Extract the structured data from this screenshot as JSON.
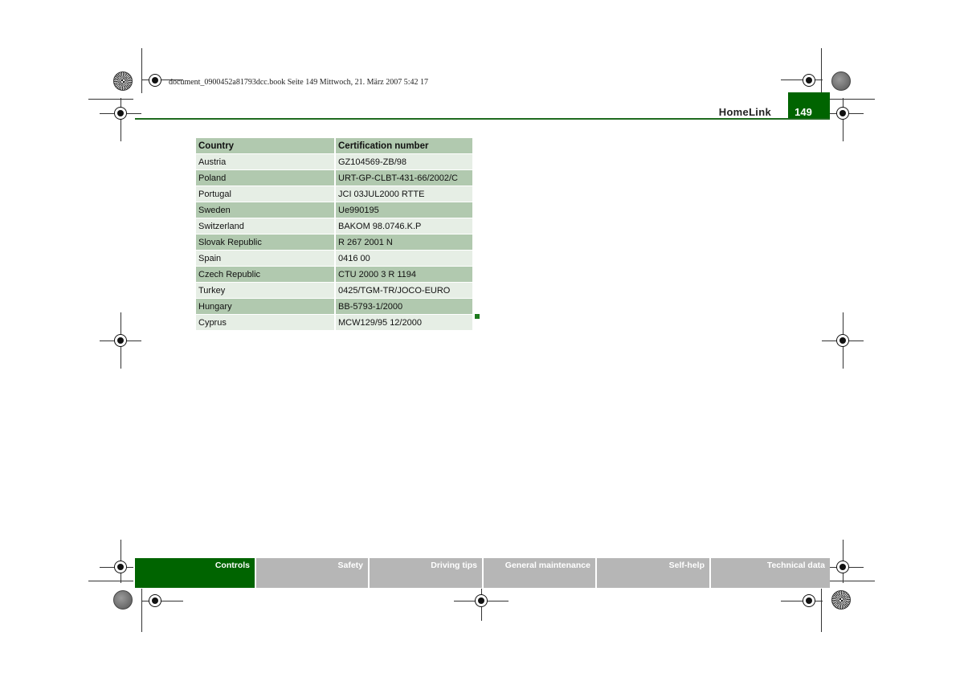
{
  "doc_info": "document_0900452a81793dcc.book  Seite 149  Mittwoch, 21. März 2007  5:42 17",
  "header": {
    "section_title": "HomeLink",
    "page_number": "149"
  },
  "table": {
    "headers": [
      "Country",
      "Certification number"
    ],
    "rows": [
      [
        "Austria",
        "GZ104569-ZB/98"
      ],
      [
        "Poland",
        "URT-GP-CLBT-431-66/2002/C"
      ],
      [
        "Portugal",
        "JCI 03JUL2000 RTTE"
      ],
      [
        "Sweden",
        "Ue990195"
      ],
      [
        "Switzerland",
        "BAKOM 98.0746.K.P"
      ],
      [
        "Slovak Republic",
        "R 267 2001 N"
      ],
      [
        "Spain",
        "0416 00"
      ],
      [
        "Czech Republic",
        "CTU 2000 3 R 1194"
      ],
      [
        "Turkey",
        "0425/TGM-TR/JOCO-EURO"
      ],
      [
        "Hungary",
        "BB-5793-1/2000"
      ],
      [
        "Cyprus",
        "MCW129/95 12/2000"
      ]
    ]
  },
  "footer_tabs": [
    "Controls",
    "Safety",
    "Driving tips",
    "General maintenance",
    "Self-help",
    "Technical data"
  ],
  "colors": {
    "accent": "#006400",
    "row_dark": "#b1c9af",
    "row_light": "#e6eee5",
    "tab_inactive": "#b6b6b6"
  }
}
